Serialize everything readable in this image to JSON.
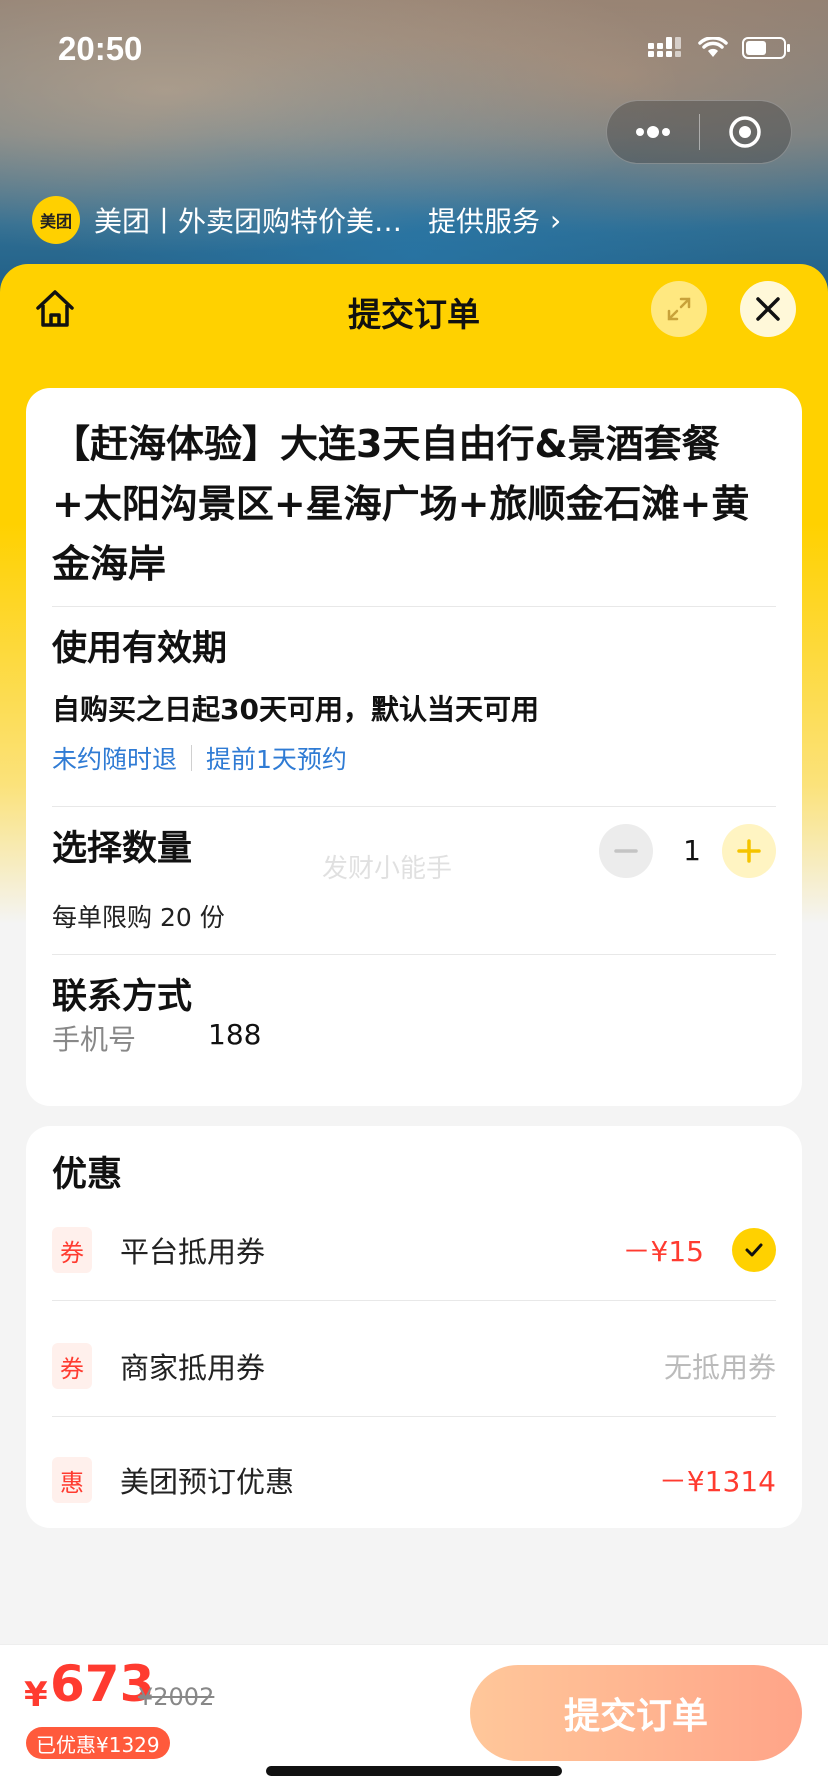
{
  "status_bar": {
    "time": "20:50"
  },
  "mini_program": {
    "logo_text": "美团",
    "name": "美团丨外卖团购特价美…",
    "service_link": "提供服务",
    "service_chevron": "›"
  },
  "sheet": {
    "title": "提交订单"
  },
  "product": {
    "title": "【赶海体验】大连3天自由行&景酒套餐+太阳沟景区+星海广场+旅顺金石滩+黄金海岸"
  },
  "validity": {
    "heading": "使用有效期",
    "text": "自购买之日起30天可用，默认当天可用",
    "tag1": "未约随时退",
    "tag2": "提前1天预约"
  },
  "quantity": {
    "heading": "选择数量",
    "value": "1",
    "limit": "每单限购 20 份",
    "watermark": "发财小能手"
  },
  "contact": {
    "heading": "联系方式",
    "phone_label": "手机号",
    "phone_value": "188"
  },
  "discounts": {
    "heading": "优惠",
    "items": [
      {
        "badge": "券",
        "name": "平台抵用券",
        "value": "－¥15",
        "checked": true
      },
      {
        "badge": "券",
        "name": "商家抵用券",
        "value": "无抵用券"
      },
      {
        "badge": "惠",
        "name": "美团预订优惠",
        "value": "－¥1314"
      }
    ]
  },
  "footer": {
    "currency": "¥",
    "price": "673",
    "original_price": "¥2002",
    "saved": "已优惠¥1329",
    "submit_label": "提交订单"
  },
  "colors": {
    "brand_yellow": "#ffd100",
    "price_red": "#ff3b30",
    "link_blue": "#2f7bd4"
  }
}
